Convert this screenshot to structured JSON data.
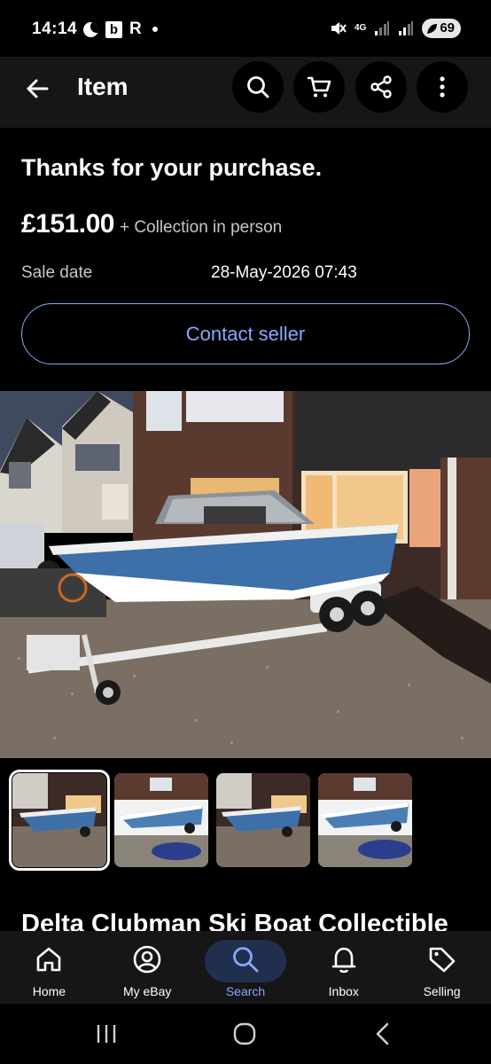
{
  "status_bar": {
    "time": "14:14",
    "b_badge": "b",
    "r_badge": "R",
    "network": "4G",
    "battery": "69"
  },
  "nav": {
    "title": "Item",
    "icons": [
      "back-arrow-icon",
      "search-icon",
      "cart-icon",
      "share-icon",
      "more-vertical-icon"
    ]
  },
  "purchase": {
    "thanks": "Thanks for your purchase.",
    "price": "£151.00",
    "delivery": "+ Collection in person",
    "sale_label": "Sale date",
    "sale_value": "28-May-2026 07:43",
    "contact_label": "Contact seller"
  },
  "gallery": {
    "thumbnail_count": 4,
    "selected_index": 0
  },
  "item": {
    "title": "Delta Clubman Ski Boat Collectible"
  },
  "tabbar": {
    "tabs": [
      {
        "label": "Home",
        "icon": "home-icon"
      },
      {
        "label": "My eBay",
        "icon": "user-icon"
      },
      {
        "label": "Search",
        "icon": "search-icon"
      },
      {
        "label": "Inbox",
        "icon": "bell-icon"
      },
      {
        "label": "Selling",
        "icon": "tag-icon"
      }
    ],
    "active": "Search"
  },
  "colors": {
    "accent": "#8aa6ff",
    "background": "#000000",
    "nav_background": "#161616",
    "active_pill": "#1f2f4d"
  }
}
